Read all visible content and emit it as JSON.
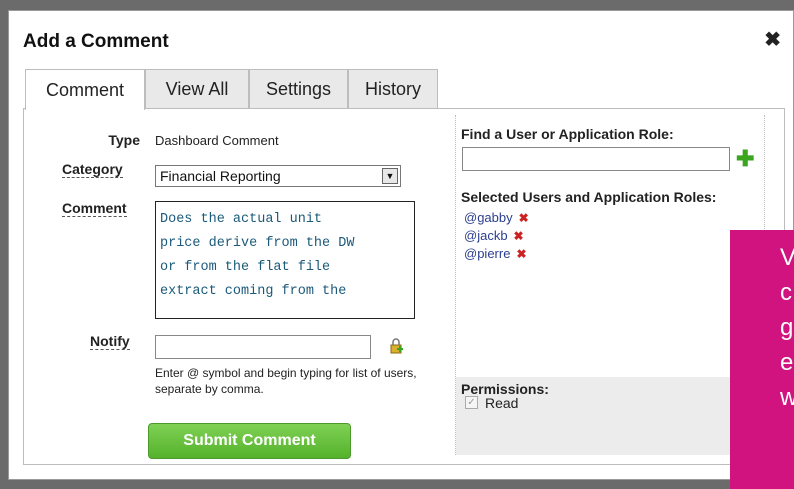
{
  "dialog": {
    "title": "Add a Comment",
    "close_icon": "close-icon"
  },
  "tabs": [
    {
      "label": "Comment",
      "active": true
    },
    {
      "label": "View All",
      "active": false
    },
    {
      "label": "Settings",
      "active": false
    },
    {
      "label": "History",
      "active": false
    }
  ],
  "form": {
    "type_label": "Type",
    "type_value": "Dashboard Comment",
    "category_label": "Category",
    "category_value": "Financial Reporting",
    "comment_label": "Comment",
    "comment_text": "Does the actual unit\nprice derive from the DW\nor from the flat file\nextract coming from the",
    "notify_label": "Notify",
    "notify_value": "",
    "notify_hint": "Enter @ symbol and begin typing for list of users, separate by comma.",
    "submit_label": "Submit Comment"
  },
  "right": {
    "find_label": "Find a User or Application Role:",
    "find_value": "",
    "selected_label": "Selected Users and Application Roles:",
    "users": [
      "@gabby",
      "@jackb",
      "@pierre"
    ],
    "remove_glyph": "✖",
    "permissions_label": "Permissions:",
    "permission_read": "Read"
  },
  "overlay": {
    "letters": [
      "V",
      "c",
      "g",
      "e",
      "w"
    ],
    "color": "#d0137f"
  },
  "colors": {
    "submit_green": "#55b22c",
    "user_link": "#2c3f8e",
    "remove_red": "#cc2222"
  }
}
